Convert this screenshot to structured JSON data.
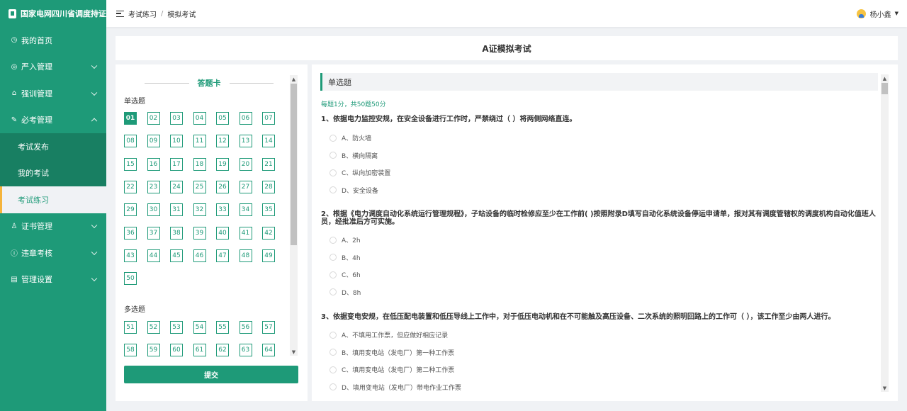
{
  "app": {
    "title": "国家电网四川省调度持证上岗..."
  },
  "sidebar": {
    "items": [
      {
        "label": "我的首页",
        "icon": "clock-icon",
        "expandable": false
      },
      {
        "label": "严入管理",
        "icon": "user-icon",
        "expandable": true
      },
      {
        "label": "强训管理",
        "icon": "building-icon",
        "expandable": true
      },
      {
        "label": "必考管理",
        "icon": "edit-icon",
        "expandable": true,
        "expanded": true,
        "children": [
          {
            "label": "考试发布",
            "active": false
          },
          {
            "label": "我的考试",
            "active": false
          },
          {
            "label": "考试练习",
            "active": true
          }
        ]
      },
      {
        "label": "证书管理",
        "icon": "certificate-icon",
        "expandable": true
      },
      {
        "label": "违章考核",
        "icon": "info-icon",
        "expandable": true
      },
      {
        "label": "管理设置",
        "icon": "settings-icon",
        "expandable": true
      }
    ]
  },
  "header": {
    "breadcrumb": [
      "考试练习",
      "模拟考试"
    ],
    "separator": "/",
    "user_name": "杨小鑫"
  },
  "exam": {
    "title": "A证模拟考试"
  },
  "answer_card": {
    "title": "答题卡",
    "single_label": "单选题",
    "single_numbers": [
      "01",
      "02",
      "03",
      "04",
      "05",
      "06",
      "07",
      "08",
      "09",
      "10",
      "11",
      "12",
      "13",
      "14",
      "15",
      "16",
      "17",
      "18",
      "19",
      "20",
      "21",
      "22",
      "23",
      "24",
      "25",
      "26",
      "27",
      "28",
      "29",
      "30",
      "31",
      "32",
      "33",
      "34",
      "35",
      "36",
      "37",
      "38",
      "39",
      "40",
      "41",
      "42",
      "43",
      "44",
      "45",
      "46",
      "47",
      "48",
      "49",
      "50"
    ],
    "multi_label": "多选题",
    "multi_numbers": [
      "51",
      "52",
      "53",
      "54",
      "55",
      "56",
      "57",
      "58",
      "59",
      "60",
      "61",
      "62",
      "63",
      "64"
    ],
    "current": "01",
    "submit_label": "提交"
  },
  "questions_panel": {
    "type_label": "单选题",
    "score_info": "每题1分，共50题50分",
    "questions": [
      {
        "text": "1、依据电力监控安规，在安全设备进行工作时，严禁绕过（ ）将两侧网络直连。",
        "options": [
          "A、防火墙",
          "B、横向隔离",
          "C、纵向加密装置",
          "D、安全设备"
        ]
      },
      {
        "text": "2、根据《电力调度自动化系统运行管理规程》，子站设备的临时检修应至少在工作前( )按照附录D填写自动化系统设备停运申请单，报对其有调度管辖权的调度机构自动化值班人员，经批准后方可实施。",
        "options": [
          "A、2h",
          "B、4h",
          "C、6h",
          "D、8h"
        ]
      },
      {
        "text": "3、依据变电安规，在低压配电装置和低压导线上工作中，对于低压电动机和在不可能触及高压设备、二次系统的照明回路上的工作可（ ），该工作至少由两人进行。",
        "options": [
          "A、不填用工作票，但应做好相应记录",
          "B、填用变电站（发电厂）第一种工作票",
          "C、填用变电站（发电厂）第二种工作票",
          "D、填用变电站（发电厂）带电作业工作票"
        ]
      }
    ]
  },
  "colors": {
    "brand": "#1e9a78",
    "active_indicator": "#f5b43c",
    "page_bg": "#f0f2f5"
  }
}
